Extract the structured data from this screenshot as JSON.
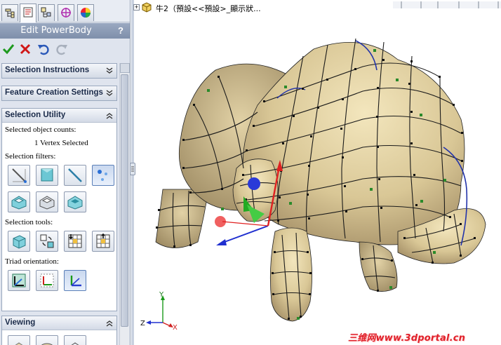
{
  "panel": {
    "title": "Edit PowerBody",
    "help": "?",
    "tabs": [
      "feature-manager-icon",
      "property-manager-icon",
      "configuration-manager-icon",
      "dimxpert-icon",
      "display-manager-icon"
    ]
  },
  "actions": [
    "ok-checkmark-icon",
    "cancel-x-icon",
    "undo-icon",
    "redo-icon"
  ],
  "groups": {
    "selection_instructions": {
      "title": "Selection Instructions"
    },
    "feature_creation": {
      "title": "Feature Creation Settings"
    },
    "selection_utility": {
      "title": "Selection Utility",
      "counts_label": "Selected object counts:",
      "count_value": "1 Vertex Selected",
      "filters_label": "Selection filters:",
      "tools_label": "Selection tools:",
      "triad_label": "Triad orientation:"
    },
    "viewing": {
      "title": "Viewing"
    }
  },
  "viewport": {
    "tree_text": "牛2（預設<<預設>_顯示狀...",
    "watermark": "三维网www.3dportal.cn",
    "triad_axes": {
      "y": "Y",
      "z": "Z",
      "x": "X"
    }
  },
  "colors": {
    "panel_bg": "#dfe4ee",
    "header_bg": "#8d9cb6",
    "model_surface": "#d9c898",
    "mesh_line": "#1a1a1a",
    "vertex_green": "#2a8a2a",
    "edge_blue": "#2233aa",
    "triad_red": "#e02020",
    "triad_green": "#22aa22",
    "triad_blue": "#2030d0",
    "watermark": "#e0202a"
  }
}
